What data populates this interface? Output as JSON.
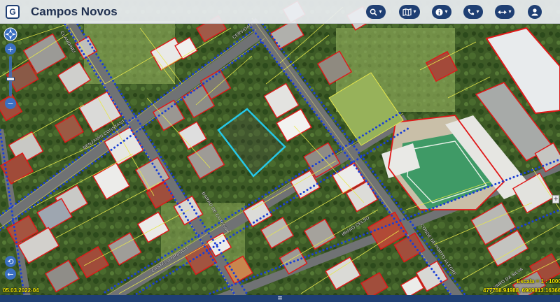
{
  "header": {
    "title": "Campos Novos",
    "logo_letter": "G",
    "background": "#ebeef2",
    "button_color": "#1f3f73",
    "buttons": [
      {
        "name": "search-menu-button",
        "icon": "search-icon",
        "caret": "▾"
      },
      {
        "name": "layers-menu-button",
        "icon": "map-icon",
        "caret": "▾"
      },
      {
        "name": "info-menu-button",
        "icon": "info-icon",
        "caret": "▾"
      },
      {
        "name": "contact-menu-button",
        "icon": "phone-icon",
        "caret": "▾"
      },
      {
        "name": "tools-menu-button",
        "icon": "measure-arrows-icon",
        "caret": "▾"
      },
      {
        "name": "user-button",
        "icon": "user-icon",
        "caret": ""
      }
    ]
  },
  "map": {
    "imagery": "aerial-satellite",
    "parcel_color": "#e8e84a",
    "building_outline_color": "#e01818",
    "network_color": "#1a3fd6",
    "selection_color": "#25c8e8",
    "street_labels": [
      {
        "text": "BENJAMIN CONSTANT",
        "name": "street-label-benjamin-constant"
      },
      {
        "text": "CERVIDAO",
        "name": "street-label-cervidao"
      },
      {
        "text": "CLAUDINEI",
        "name": "street-label-claudinei"
      },
      {
        "text": "BARAO DE COTEGIPE",
        "name": "street-label-barao-de-cotegipe"
      },
      {
        "text": "CASTELO BRANCO",
        "name": "street-label-castelo-branco"
      },
      {
        "text": "IRMAO CELSO",
        "name": "street-label-irmao-celso"
      },
      {
        "text": "CONDE DE PORTO ALEGRE",
        "name": "street-label-conde-porto-alegre"
      },
      {
        "text": "ALVARO DA SILVA",
        "name": "street-label-alvaro-da-silva"
      }
    ]
  },
  "controls": {
    "zoom_in": "+",
    "zoom_out": "−",
    "pan_icon": "compass-icon",
    "back_arrow": "←",
    "refresh_arrow": "⟲",
    "expand": "+"
  },
  "status": {
    "date": "05.03.2022-04",
    "scale": "Escala = 1 : 1000",
    "coordinates": "477758.94988, 6969813.16366"
  },
  "footer": {
    "toggle": "≡"
  }
}
